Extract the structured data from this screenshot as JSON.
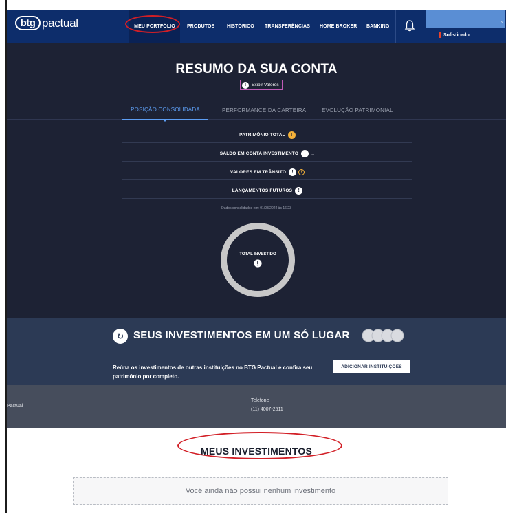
{
  "brand": {
    "logo_mark": "btg",
    "logo_word": "pactual"
  },
  "nav": {
    "items": [
      {
        "label": "MEU PORTFÓLIO"
      },
      {
        "label": "PRODUTOS"
      },
      {
        "label": "HISTÓRICO"
      },
      {
        "label": "TRANSFERÊNCIAS"
      },
      {
        "label": "HOME BROKER"
      },
      {
        "label": "BANKING"
      }
    ],
    "user_tier": "Sofisticado",
    "user_caret": "ˇ"
  },
  "summary": {
    "title": "RESUMO DA SUA CONTA",
    "show_values": "Exibir Valores",
    "tabs": [
      {
        "label": "POSIÇÃO CONSOLIDADA"
      },
      {
        "label": "PERFORMANCE DA CARTEIRA"
      },
      {
        "label": "EVOLUÇÃO PATRIMONIAL"
      }
    ],
    "rows": [
      {
        "label": "PATRIMÔNIO TOTAL"
      },
      {
        "label": "SALDO EM CONTA INVESTIMENTO"
      },
      {
        "label": "VALORES EM TRÂNSITO"
      },
      {
        "label": "LANÇAMENTOS FUTUROS"
      }
    ],
    "consolidated": "Dados consolidados em: 01/08/2024 às 16:23",
    "donut_label": "TOTAL INVESTIDO"
  },
  "promo": {
    "title": "SEUS INVESTIMENTOS EM UM SÓ LUGAR",
    "description": "Reúna os investimentos de outras instituições no BTG Pactual e confira seu patrimônio por completo.",
    "button": "ADICIONAR INSTITUIÇÕES"
  },
  "footer": {
    "left": "Pactual",
    "tel_label": "Telefone",
    "tel": "(11) 4007-2511"
  },
  "investments": {
    "title": "MEUS INVESTIMENTOS",
    "empty": "Você ainda não possui nenhum investimento"
  },
  "colors": {
    "navbar": "#0d2d6b",
    "panel": "#1d2234",
    "accent_tab": "#5d9ef3",
    "gold": "#f3b13a",
    "annotation": "#d21f26"
  }
}
